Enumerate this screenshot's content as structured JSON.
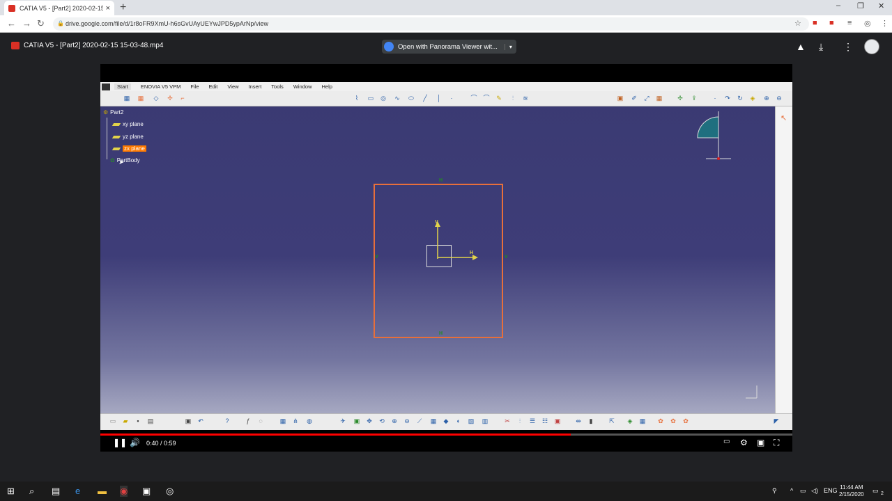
{
  "browser": {
    "tab_title": "CATIA V5 - [Part2] 2020-02-15 15",
    "tab_close": "×",
    "new_tab": "+",
    "url": "drive.google.com/file/d/1r8oFR9XmU-h6sGvUAyUEYwJPD5ypArNp/view"
  },
  "drive": {
    "filename": "CATIA V5 - [Part2] 2020-02-15 15-03-48.mp4",
    "open_with": "Open with Panorama Viewer wit...",
    "open_with_caret": "▾"
  },
  "catia": {
    "menu": [
      "Start",
      "ENOVIA V5 VPM",
      "File",
      "Edit",
      "View",
      "Insert",
      "Tools",
      "Window",
      "Help"
    ],
    "tree": {
      "root": "Part2",
      "xy": "xy plane",
      "yz": "yz plane",
      "zx": "zx plane",
      "body": "PartBody"
    },
    "constraints": {
      "top": "H",
      "bottom": "H",
      "left": "V",
      "right": "V"
    },
    "axis_h": "H",
    "axis_v": "V"
  },
  "player": {
    "time": "0:40 / 0:59",
    "progress": 0.68
  },
  "taskbar": {
    "lang": "ENG",
    "time": "11:44 AM",
    "date": "2/15/2020",
    "notif": "2"
  },
  "colors": {
    "accent_red": "#d93025",
    "sketch_border": "#e76f3b",
    "selection": "#ff7a00"
  }
}
